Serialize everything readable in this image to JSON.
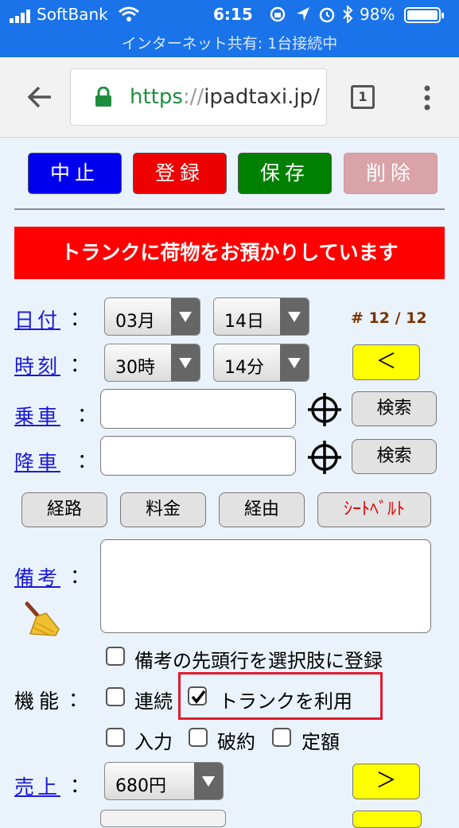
{
  "status_bar": {
    "carrier": "SoftBank",
    "time": "6:15",
    "battery": "98%",
    "hotspot": "インターネット共有: 1台接続中"
  },
  "browser": {
    "url_scheme": "https",
    "url_sep": "://",
    "url_host": "ipadtaxi.jp/",
    "tab_count": "1"
  },
  "actions": {
    "cancel": "中止",
    "register": "登録",
    "save": "保存",
    "delete": "削除"
  },
  "banner": "トランクに荷物をお預かりしています",
  "form": {
    "date_label": "日付",
    "month": "03月",
    "day": "14日",
    "record_counter": "# 12 / 12",
    "time_label": "時刻",
    "hour": "30時",
    "minute": "14分",
    "prev_button": "＜",
    "pickup_label": "乗車",
    "pickup_value": "",
    "search_button": "検索",
    "dropoff_label": "降車",
    "dropoff_value": "",
    "route_button": "経路",
    "fare_button": "料金",
    "via_button": "経由",
    "seatbelt_button": "ｼｰﾄﾍﾞﾙﾄ",
    "notes_label": "備考",
    "notes_value": "",
    "register_first_line": "備考の先頭行を選択肢に登録",
    "functions_label": "機能",
    "continuous": "連続",
    "use_trunk": "トランクを利用",
    "input": "入力",
    "cancel_contract": "破約",
    "fixed_fare": "定額",
    "sales_label": "売上",
    "sales_value": "680円",
    "next_button": "＞"
  },
  "colors": {
    "cancel": "#0000ee",
    "register": "#ee0000",
    "save": "#008000",
    "delete": "#d9a3a8",
    "banner": "#ff0000",
    "highlight": "#ffff00"
  }
}
